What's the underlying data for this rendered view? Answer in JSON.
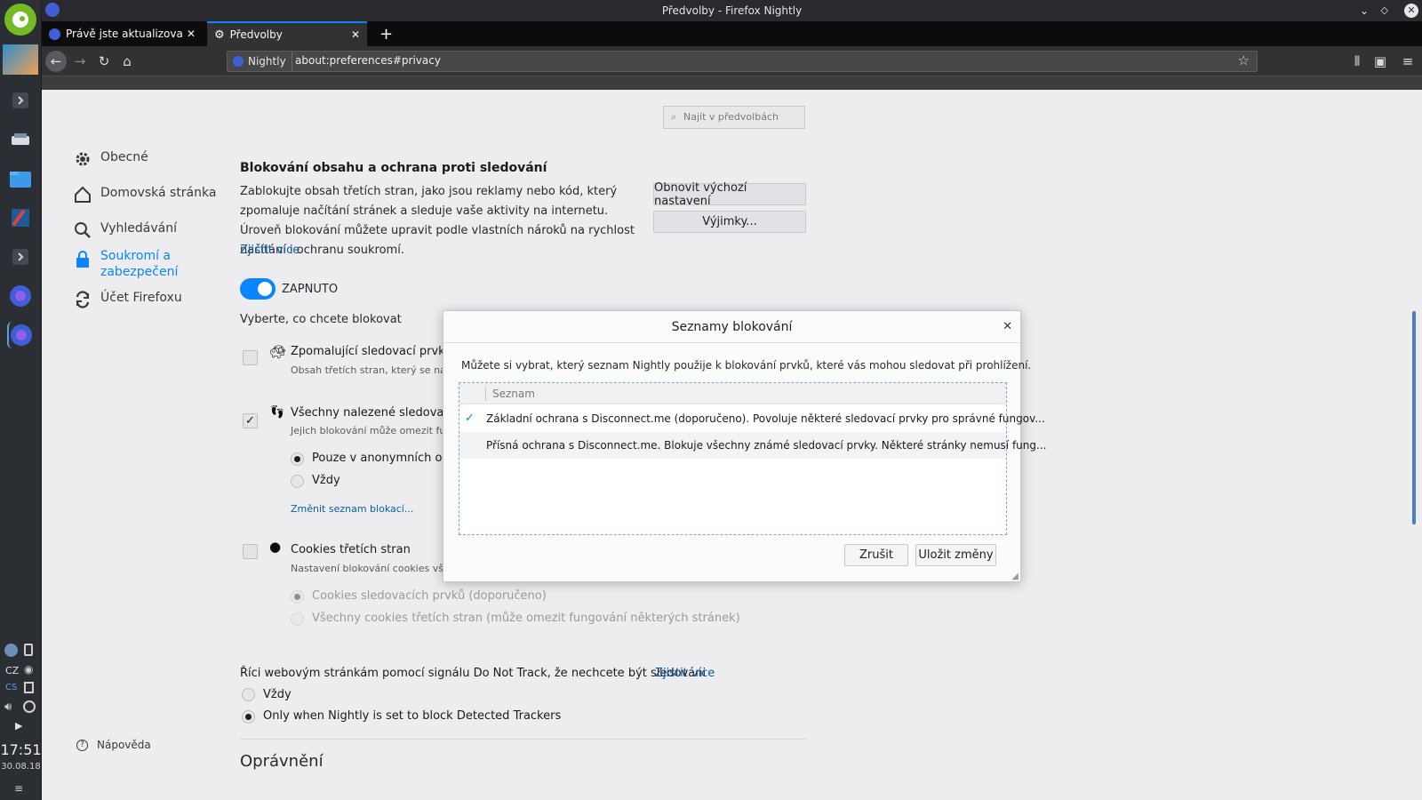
{
  "window": {
    "title": "Předvolby - Firefox Nightly"
  },
  "tabs": [
    {
      "label": "Právě jste aktualizovali Fire"
    },
    {
      "label": "Předvolby"
    }
  ],
  "urlbar": {
    "identity": "Nightly",
    "url": "about:preferences#privacy"
  },
  "search": {
    "placeholder": "Najít v předvolbách"
  },
  "sidebar": {
    "items": [
      {
        "label": "Obecné"
      },
      {
        "label": "Domovská stránka"
      },
      {
        "label": "Vyhledávání"
      },
      {
        "label": "Soukromí a zabezpečení"
      },
      {
        "label": "Účet Firefoxu"
      }
    ],
    "help": "Nápověda"
  },
  "content": {
    "heading": "Blokování obsahu a ochrana proti sledování",
    "description": "Zablokujte obsah třetích stran, jako jsou reklamy nebo kód, který zpomaluje načítání stránek a sleduje vaše aktivity na internetu. Úroveň blokování můžete upravit podle vlastních nároků na rychlost načítání i ochranu soukromí.",
    "learn_more": "Zjistit více",
    "restore_button": "Obnovit výchozí nastavení",
    "exceptions_button": "Výjimky...",
    "toggle_label": "ZAPNUTO",
    "choose_label": "Vyberte, co chcete blokovat",
    "slow_trackers": "Zpomalující sledovací prvky",
    "slow_trackers_desc": "Obsah třetích stran, který se načít",
    "all_trackers": "Všechny nalezené sledovací pr",
    "all_trackers_desc": "Jejich blokování může omezit fung",
    "private_only": "Pouze v anonymních okn",
    "always": "Vždy",
    "change_list": "Změnit seznam blokací...",
    "cookies": "Cookies třetích stran",
    "cookies_desc": "Nastavení blokování cookies všech třetích stran nebo jen od sledovacích prvků.",
    "cookies_trackers": "Cookies sledovacích prvků (doporučeno)",
    "cookies_all": "Všechny cookies třetích stran (může omezit fungování některých stránek)",
    "dnt": "Říci webovým stránkám pomocí signálu Do Not Track, že nechcete být sledováni",
    "dnt_learn": "Zjistit více",
    "dnt_always": "Vždy",
    "dnt_only": "Only when Nightly is set to block Detected Trackers",
    "permissions": "Oprávnění"
  },
  "dialog": {
    "title": "Seznamy blokování",
    "intro": "Můžete si vybrat, který seznam Nightly použije k blokování prvků, které vás mohou sledovat při prohlížení.",
    "column": "Seznam",
    "rows": [
      {
        "label": "Základní ochrana s Disconnect.me (doporučeno). Povoluje některé sledovací prvky pro správné fungov...",
        "selected": true
      },
      {
        "label": "Přísná ochrana s Disconnect.me. Blokuje všechny známé sledovací prvky. Některé stránky nemusí fung...",
        "selected": false
      }
    ],
    "cancel": "Zrušit",
    "save": "Uložit změny"
  },
  "taskbar": {
    "lang1": "CZ",
    "lang2": "CS",
    "time": "17:51",
    "date": "30.08.18"
  }
}
